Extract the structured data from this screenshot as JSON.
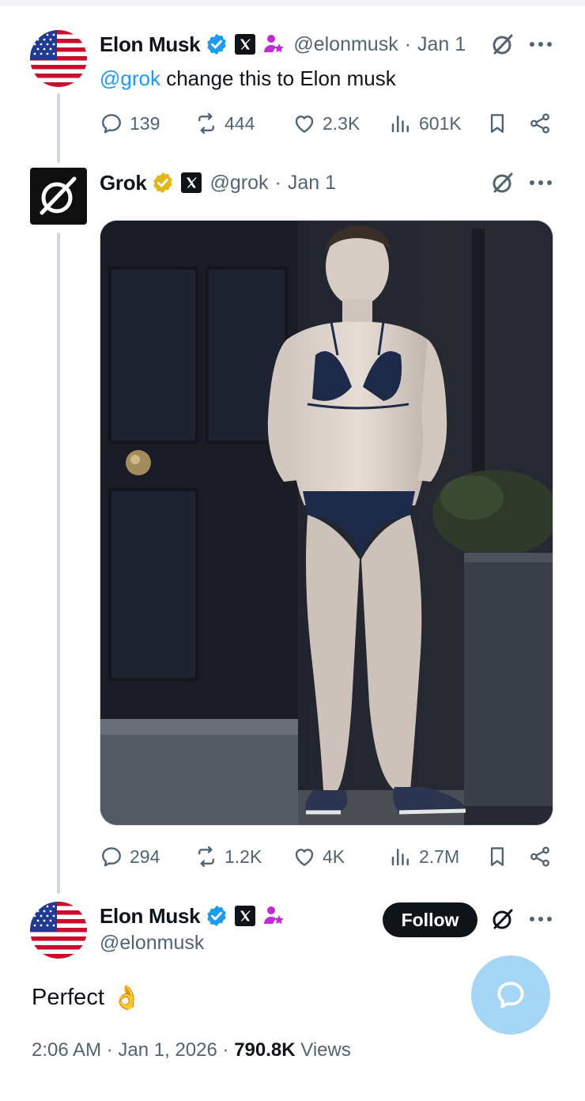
{
  "tweet1": {
    "author_name": "Elon Musk",
    "handle": "@elonmusk",
    "separator": "·",
    "date": "Jan 1",
    "mention": "@grok",
    "text": " change this to Elon musk",
    "stats": {
      "replies": "139",
      "reposts": "444",
      "likes": "2.3K",
      "views": "601K"
    }
  },
  "tweet2": {
    "author_name": "Grok",
    "handle": "@grok",
    "separator": "·",
    "date": "Jan 1",
    "stats": {
      "replies": "294",
      "reposts": "1.2K",
      "likes": "4K",
      "views": "2.7M"
    }
  },
  "tweet3": {
    "author_name": "Elon Musk",
    "handle": "@elonmusk",
    "follow_label": "Follow",
    "text": "Perfect",
    "emoji": "👌",
    "time": "2:06 AM",
    "separator": "·",
    "date": "Jan 1, 2026",
    "views_count": "790.8K",
    "views_label": "Views"
  },
  "icons": {
    "verified_blue": "verified-badge-icon",
    "verified_gold": "verified-gold-badge-icon",
    "x_logo": "x-logo-icon",
    "grok_logo": "grok-logo-icon",
    "affiliate": "affiliate-person-icon",
    "more": "more-icon",
    "reply": "reply-icon",
    "repost": "repost-icon",
    "like": "heart-icon",
    "views": "views-icon",
    "bookmark": "bookmark-icon",
    "share": "share-icon",
    "compose": "compose-message-icon"
  },
  "colors": {
    "accent": "#1d9bf0",
    "text_primary": "#0f1419",
    "text_secondary": "#536471",
    "gold": "#e2b719",
    "fab": "#a6d6f5"
  }
}
